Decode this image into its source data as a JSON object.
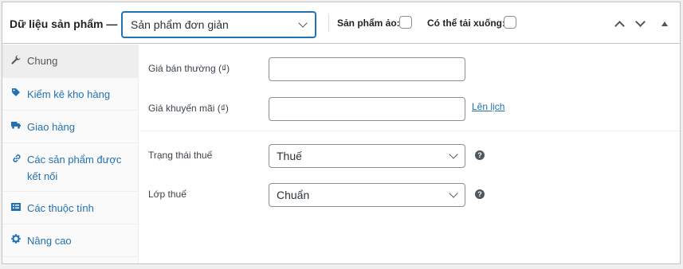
{
  "header": {
    "title": "Dữ liệu sản phẩm —",
    "product_type": "Sản phẩm đơn giản",
    "virtual_label": "Sản phẩm ảo:",
    "downloadable_label": "Có thể tải xuống:"
  },
  "tabs": [
    {
      "label": "Chung",
      "icon": "wrench-icon"
    },
    {
      "label": "Kiểm kê kho hàng",
      "icon": "tag-icon"
    },
    {
      "label": "Giao hàng",
      "icon": "truck-icon"
    },
    {
      "label": "Các sản phẩm được kết nối",
      "icon": "link-icon"
    },
    {
      "label": "Các thuộc tính",
      "icon": "list-icon"
    },
    {
      "label": "Nâng cao",
      "icon": "gear-icon"
    }
  ],
  "general": {
    "regular_price_label": "Giá bán thường (₫)",
    "regular_price_value": "",
    "sale_price_label": "Giá khuyến mãi (₫)",
    "sale_price_value": "",
    "schedule_link": "Lên lịch",
    "tax_status_label": "Trạng thái thuế",
    "tax_status_value": "Thuế",
    "tax_class_label": "Lớp thuế",
    "tax_class_value": "Chuẩn",
    "help_glyph": "?"
  },
  "colors": {
    "accent": "#2271b1",
    "border": "#c3c4c7",
    "active_tab_bg": "#eeeeee"
  }
}
